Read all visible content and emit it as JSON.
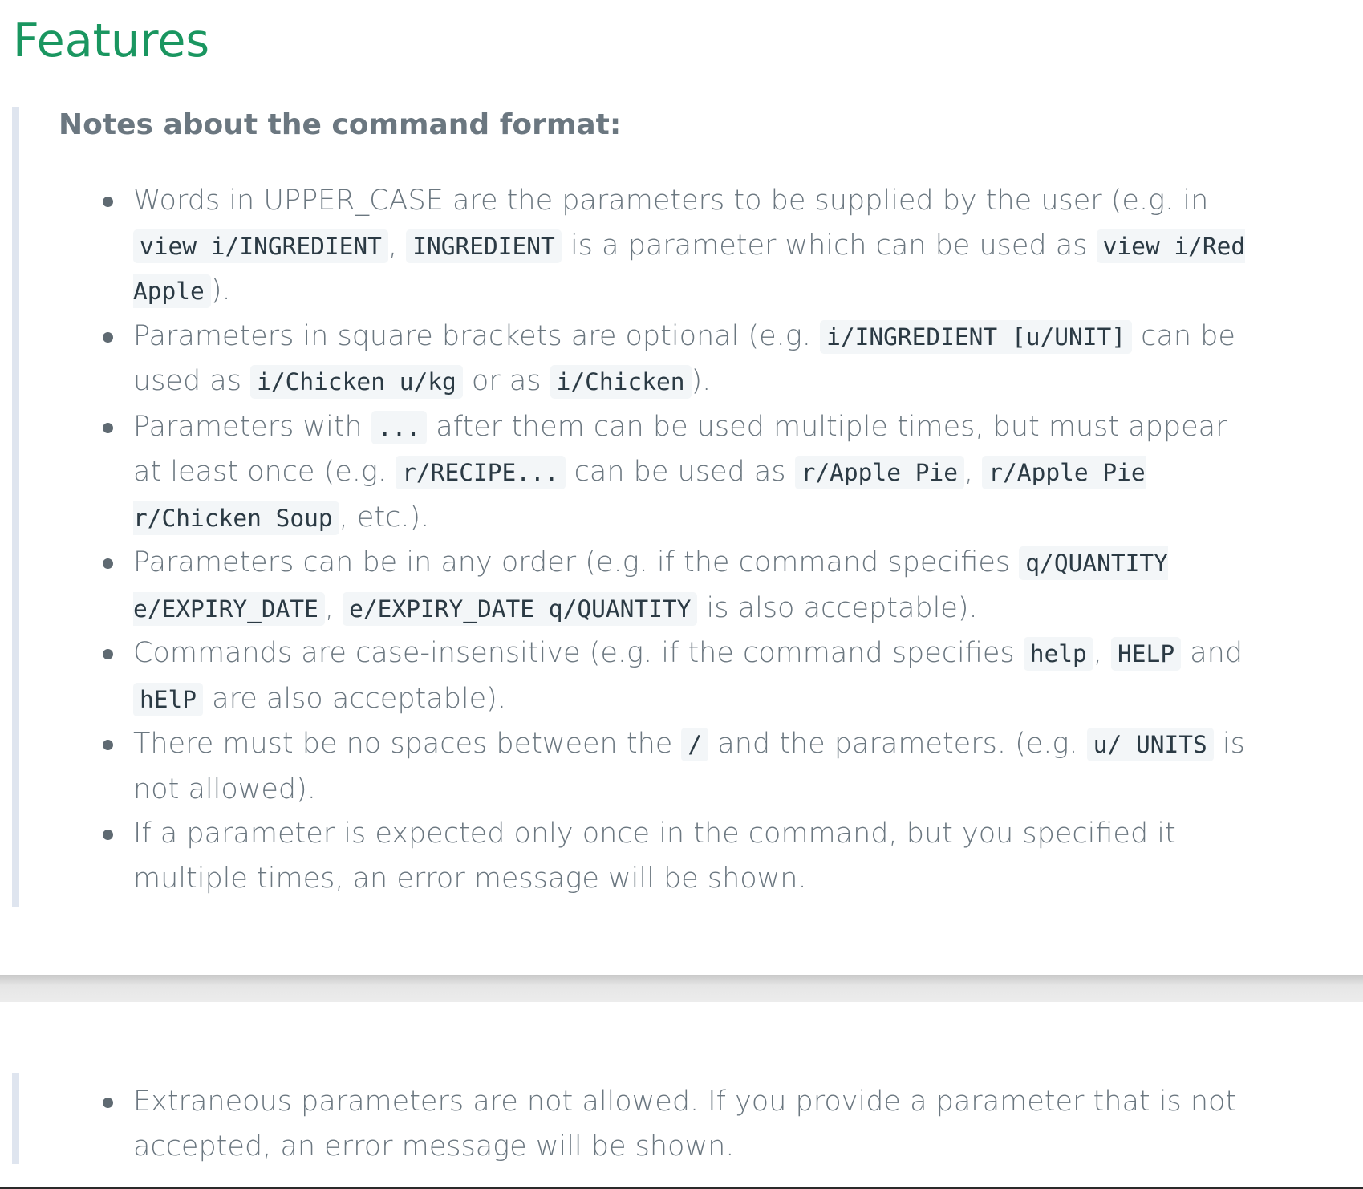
{
  "heading": "Features",
  "notes_title": "Notes about the command format:",
  "rules": [
    [
      {
        "t": "Words in UPPER_CASE are the parameters to be supplied by the user (e.g. in "
      },
      {
        "c": "view i/INGREDIENT"
      },
      {
        "t": ", "
      },
      {
        "c": "INGREDIENT"
      },
      {
        "t": " is a parameter which can be used as "
      },
      {
        "c": "view i/Red Apple"
      },
      {
        "t": ")."
      }
    ],
    [
      {
        "t": "Parameters in square brackets are optional (e.g. "
      },
      {
        "c": "i/INGREDIENT [u/UNIT]"
      },
      {
        "t": " can be used as "
      },
      {
        "c": "i/Chicken u/kg"
      },
      {
        "t": " or as "
      },
      {
        "c": "i/Chicken"
      },
      {
        "t": ")."
      }
    ],
    [
      {
        "t": "Parameters with "
      },
      {
        "c": "..."
      },
      {
        "t": " after them can be used multiple times, but must appear at least once (e.g. "
      },
      {
        "c": "r/RECIPE..."
      },
      {
        "t": " can be used as "
      },
      {
        "c": "r/Apple Pie"
      },
      {
        "t": ", "
      },
      {
        "c": "r/Apple Pie r/Chicken Soup"
      },
      {
        "t": ", etc.)."
      }
    ],
    [
      {
        "t": "Parameters can be in any order (e.g. if the command specifies "
      },
      {
        "c": "q/QUANTITY e/EXPIRY_DATE"
      },
      {
        "t": ", "
      },
      {
        "c": "e/EXPIRY_DATE q/QUANTITY"
      },
      {
        "t": " is also acceptable)."
      }
    ],
    [
      {
        "t": "Commands are case-insensitive (e.g. if the command specifies "
      },
      {
        "c": "help"
      },
      {
        "t": ", "
      },
      {
        "c": "HELP"
      },
      {
        "t": " and "
      },
      {
        "c": "hElP"
      },
      {
        "t": " are also acceptable)."
      }
    ],
    [
      {
        "t": "There must be no spaces between the "
      },
      {
        "c": "/"
      },
      {
        "t": " and the parameters. (e.g. "
      },
      {
        "c": "u/ UNITS"
      },
      {
        "t": " is not allowed)."
      }
    ],
    [
      {
        "t": "If a parameter is expected only once in the command, but you specified it multiple times, an error message will be shown."
      }
    ]
  ],
  "continued_rules": [
    [
      {
        "t": "Extraneous parameters are not allowed. If you provide a parameter that is not accepted, an error message will be shown."
      }
    ]
  ]
}
